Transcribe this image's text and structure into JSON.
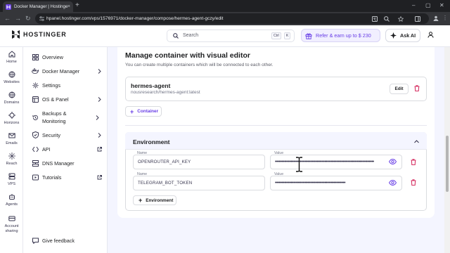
{
  "browser": {
    "tab_title": "Docker Manager | Hostinger",
    "tab_close": "×",
    "new_tab": "+",
    "url": "hpanel.hostinger.com/vps/1576971/docker-manager/compose/hermes-agent-gczy/edit"
  },
  "header": {
    "logo_text": "HOSTINGER",
    "search_placeholder": "Search",
    "search_key_1": "Ctrl",
    "search_key_2": "K",
    "refer_label": "Refer & earn up to $ 230",
    "ask_ai_label": "Ask AI"
  },
  "rail": {
    "items": [
      {
        "label": "Home",
        "icon": "home-icon"
      },
      {
        "label": "Websites",
        "icon": "globe-icon"
      },
      {
        "label": "Domains",
        "icon": "globe-icon"
      },
      {
        "label": "Horizons",
        "icon": "horizons-icon"
      },
      {
        "label": "Emails",
        "icon": "mail-icon"
      },
      {
        "label": "Reach",
        "icon": "reach-icon"
      },
      {
        "label": "VPS",
        "icon": "server-icon"
      },
      {
        "label": "Agents",
        "icon": "agents-icon"
      },
      {
        "label": "Account sharing",
        "icon": "account-sharing-icon"
      }
    ]
  },
  "sidebar": {
    "items": [
      {
        "label": "Overview",
        "icon": "overview-icon",
        "trailing": ""
      },
      {
        "label": "Docker Manager",
        "icon": "docker-icon",
        "trailing": "chevron"
      },
      {
        "label": "Settings",
        "icon": "gear-icon",
        "trailing": ""
      },
      {
        "label": "OS & Panel",
        "icon": "os-panel-icon",
        "trailing": "chevron"
      },
      {
        "label": "Backups & Monitoring",
        "icon": "backup-icon",
        "trailing": "chevron"
      },
      {
        "label": "Security",
        "icon": "shield-icon",
        "trailing": "chevron"
      },
      {
        "label": "API",
        "icon": "api-icon",
        "trailing": "external"
      },
      {
        "label": "DNS Manager",
        "icon": "dns-icon",
        "trailing": ""
      },
      {
        "label": "Tutorials",
        "icon": "tutorials-icon",
        "trailing": "external"
      }
    ],
    "feedback_label": "Give feedback"
  },
  "main": {
    "title": "Manage container with visual editor",
    "subtitle": "You can create multiple containers which will be connected to each other.",
    "container": {
      "name": "hermes-agent",
      "image": "nousresearch/hermes-agent:latest",
      "edit_label": "Edit"
    },
    "add_container_label": "Container",
    "environment": {
      "title": "Environment",
      "name_label": "Name",
      "value_label": "Value",
      "rows": [
        {
          "name": "OPENROUTER_API_KEY",
          "value": "••••••••••••••••••••••••••••••••••••••••••••••••••••••••••••••••••••••••••••"
        },
        {
          "name": "TELEGRAM_BOT_TOKEN",
          "value": "••••••••••••••••••••••••••••••••••••••••••••••••••••••"
        }
      ],
      "add_label": "Environment"
    }
  },
  "colors": {
    "accent": "#673de6",
    "danger": "#d63163",
    "background": "#f4f5ff"
  }
}
